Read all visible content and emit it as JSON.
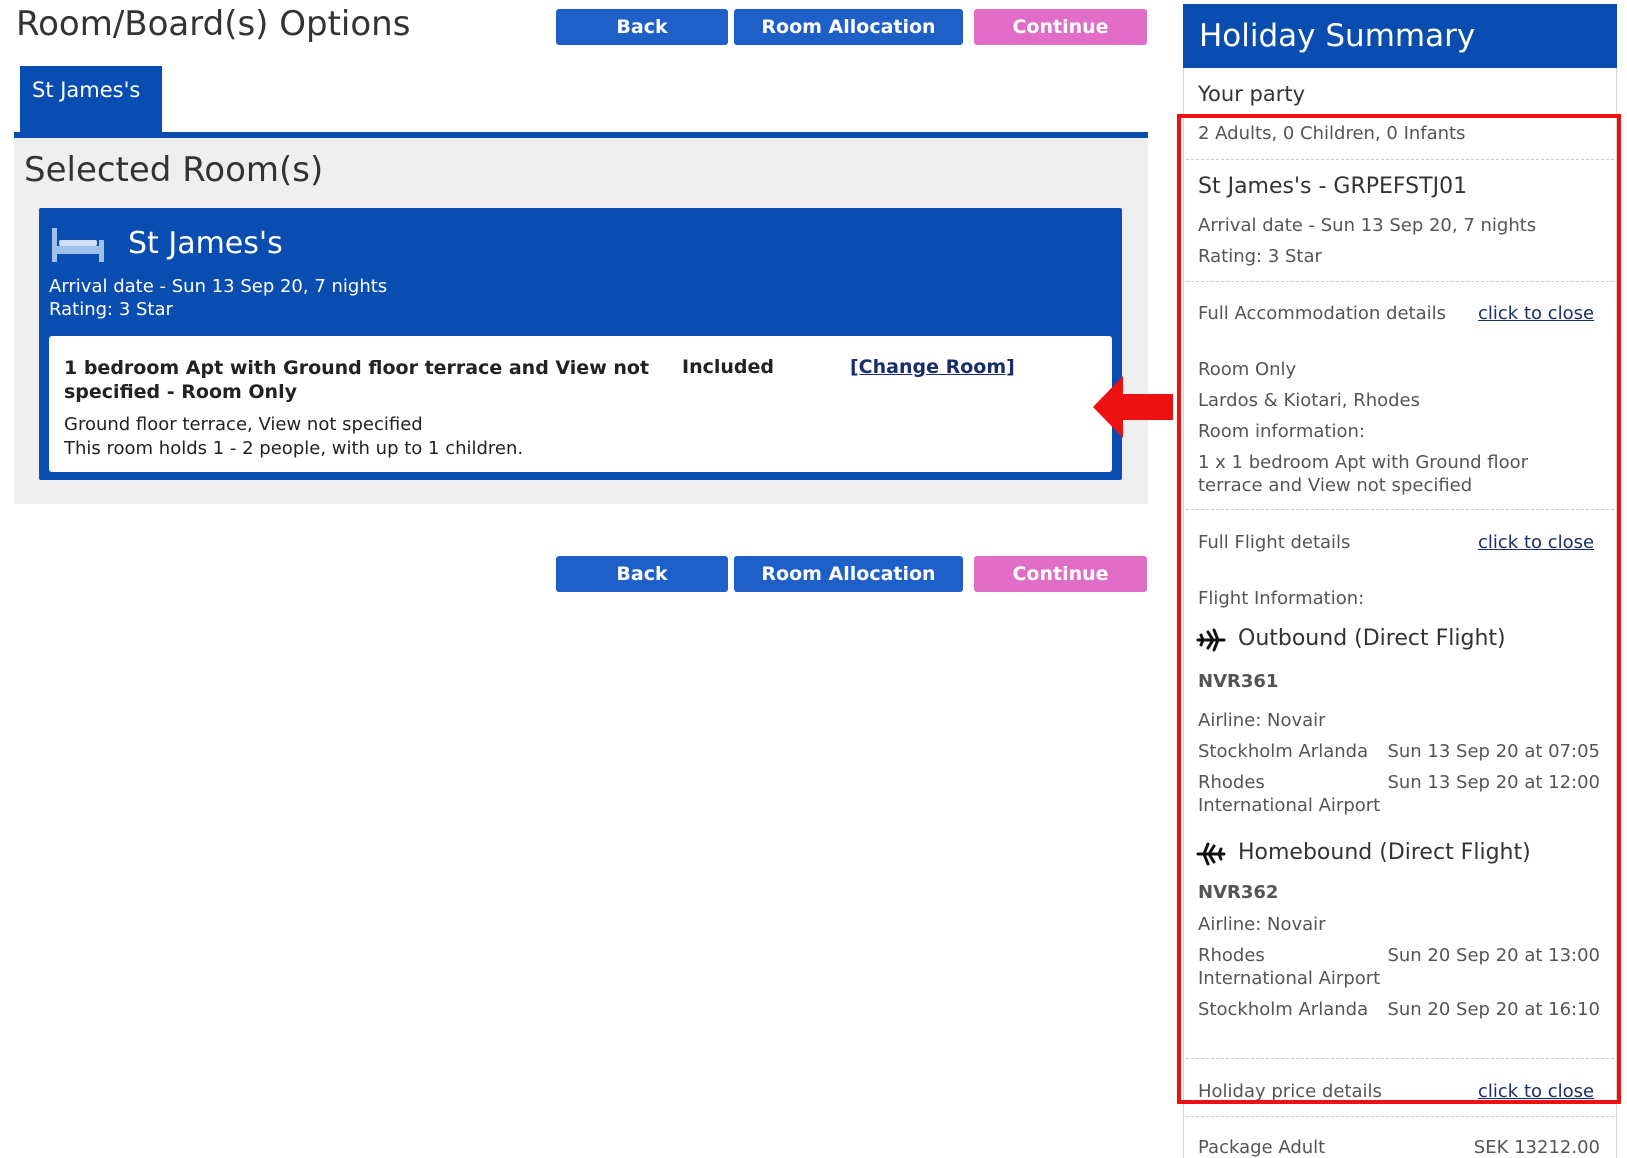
{
  "page": {
    "title": "Room/Board(s) Options"
  },
  "nav_top": {
    "back": "Back",
    "room_allocation": "Room Allocation",
    "continue": "Continue"
  },
  "nav_bottom": {
    "back": "Back",
    "room_allocation": "Room Allocation",
    "continue": "Continue"
  },
  "tabs": [
    {
      "label": "St James's"
    }
  ],
  "selected": {
    "heading": "Selected Room(s)",
    "hotel": {
      "icon": "bed-icon",
      "name": "St James's",
      "arrival": "Arrival date - Sun 13 Sep 20, 7 nights",
      "rating": "Rating: 3 Star"
    },
    "room": {
      "title": "1 bedroom Apt with Ground floor terrace and View not specified - Room Only",
      "status": "Included",
      "change_link": "[Change Room]",
      "desc1": "Ground floor terrace, View not specified",
      "desc2": "This room holds 1 - 2 people, with up to 1 children."
    }
  },
  "summary": {
    "title": "Holiday Summary",
    "party_label": "Your party",
    "party_value": "2 Adults, 0 Children, 0 Infants",
    "hotel_code": "St James's - GRPEFSTJ01",
    "arrival": "Arrival date - Sun 13 Sep 20, 7 nights",
    "rating": "Rating: 3 Star",
    "accommodation": {
      "label": "Full Accommodation details",
      "toggle": "click to close",
      "board": "Room Only",
      "location": "Lardos & Kiotari, Rhodes",
      "room_info_label": "Room information:",
      "room_info_1": "1 x 1 bedroom Apt with Ground floor",
      "room_info_2": "terrace and View not specified"
    },
    "flights": {
      "label": "Full Flight details",
      "toggle": "click to close",
      "info_label": "Flight Information:",
      "outbound": {
        "icon": "plane-right-icon",
        "title": "Outbound (Direct Flight)",
        "code": "NVR361",
        "airline": "Airline:  Novair",
        "from_place": "Stockholm Arlanda",
        "from_time": "Sun 13 Sep 20 at 07:05",
        "to_place_1": "Rhodes",
        "to_place_2": "International Airport",
        "to_time": "Sun 13 Sep 20 at 12:00"
      },
      "homebound": {
        "icon": "plane-left-icon",
        "title": "Homebound (Direct Flight)",
        "code": "NVR362",
        "airline": "Airline:  Novair",
        "from_place_1": "Rhodes",
        "from_place_2": "International Airport",
        "from_time": "Sun 20 Sep 20 at 13:00",
        "to_place": "Stockholm Arlanda",
        "to_time": "Sun 20 Sep 20 at 16:10"
      }
    },
    "price": {
      "label": "Holiday price details",
      "toggle": "click to close",
      "row_label": "Package Adult",
      "row_value": "SEK 13212.00"
    }
  },
  "colors": {
    "brand_blue": "#0a4db0",
    "button_blue": "#1f5fc8",
    "continue_pink": "#e16dc6",
    "highlight_red": "#ee1111"
  }
}
